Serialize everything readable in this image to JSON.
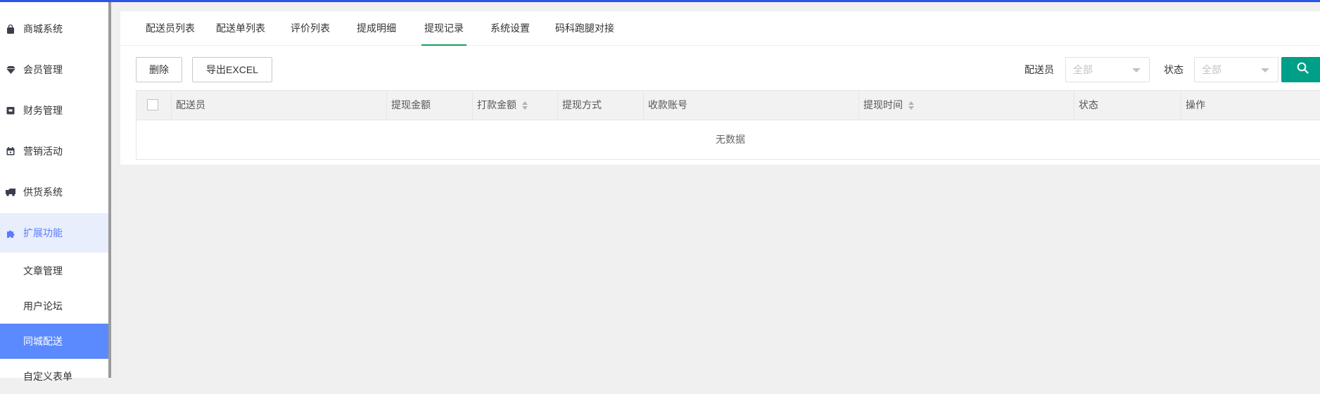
{
  "sidebar": {
    "items": [
      {
        "label": "商城系统",
        "icon": "bag-icon"
      },
      {
        "label": "会员管理",
        "icon": "diamond-icon"
      },
      {
        "label": "财务管理",
        "icon": "wallet-icon"
      },
      {
        "label": "营销活动",
        "icon": "calendar-icon"
      },
      {
        "label": "供货系统",
        "icon": "truck-icon"
      },
      {
        "label": "扩展功能",
        "icon": "puzzle-icon"
      }
    ],
    "subitems": [
      {
        "label": "文章管理"
      },
      {
        "label": "用户论坛"
      },
      {
        "label": "同城配送"
      },
      {
        "label": "自定义表单"
      }
    ]
  },
  "tabs": [
    {
      "label": "配送员列表"
    },
    {
      "label": "配送单列表"
    },
    {
      "label": "评价列表"
    },
    {
      "label": "提成明细"
    },
    {
      "label": "提现记录"
    },
    {
      "label": "系统设置"
    },
    {
      "label": "码科跑腿对接"
    }
  ],
  "toolbar": {
    "delete_label": "删除",
    "export_label": "导出EXCEL"
  },
  "filters": {
    "courier_label": "配送员",
    "courier_value": "全部",
    "status_label": "状态",
    "status_value": "全部"
  },
  "table": {
    "columns": [
      {
        "label": "配送员"
      },
      {
        "label": "提现金额"
      },
      {
        "label": "打款金额"
      },
      {
        "label": "提现方式"
      },
      {
        "label": "收款账号"
      },
      {
        "label": "提现时间"
      },
      {
        "label": "状态"
      },
      {
        "label": "操作"
      }
    ],
    "empty_text": "无数据"
  },
  "colors": {
    "accent": "#009f88",
    "tab_active": "#14a060",
    "sidebar_active": "#5b8aff",
    "top_line": "#2d55e8"
  }
}
